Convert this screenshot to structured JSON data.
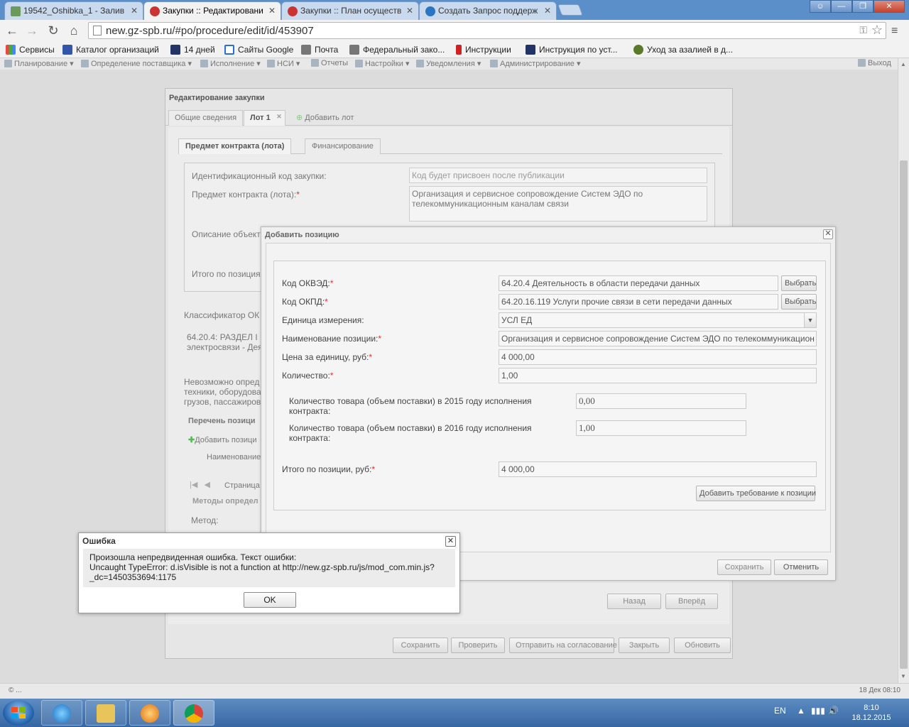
{
  "browser": {
    "tabs": [
      {
        "label": "19542_Oshibka_1 - Залив"
      },
      {
        "label": "Закупки :: Редактировани"
      },
      {
        "label": "Закупки :: План осуществ"
      },
      {
        "label": "Создать Запрос поддерж"
      }
    ],
    "url": "new.gz-spb.ru/#po/procedure/edit/id/453907",
    "bookmarks": [
      "Сервисы",
      "Каталог организаций",
      "14 дней",
      "Сайты Google",
      "Почта",
      "Федеральный зако...",
      "Инструкции",
      "Инструкция по уст...",
      "Уход за азалией в д..."
    ]
  },
  "app_menu": {
    "items": [
      "Планирование",
      "Определение поставщика",
      "Исполнение",
      "НСИ",
      "Отчеты",
      "Настройки",
      "Уведомления",
      "Администрирование"
    ],
    "exit_label": "Выход"
  },
  "main_window": {
    "title": "Редактирование закупки",
    "tabs": [
      "Общие сведения",
      "Лот 1",
      "Добавить лот"
    ],
    "subtabs": [
      "Предмет контракта (лота)",
      "Финансирование"
    ],
    "fields": {
      "id_code_label": "Идентификационный код закупки:",
      "id_code_placeholder": "Код будет присвоен после публикации",
      "subject_label": "Предмет контракта (лота):",
      "subject_value": "Организация и сервисное сопровождение Систем ЭДО по телекоммуникационным каналам связи",
      "description_label": "Описание объекта",
      "total_label": "Итого по позиция",
      "classifier_label": "Классификатор ОК",
      "classifier_text": "64.20.4: РАЗДЕЛ I",
      "classifier_text2": "электросвязи - Дея",
      "impossible_text1": "Невозможно опред",
      "impossible_text2": "техники, оборудова",
      "impossible_text3": "грузов, пассажиров",
      "positions_title": "Перечень позици",
      "add_position": "Добавить позици",
      "col_name": "Наименование",
      "page_label": "Страница",
      "methods_title": "Методы определ",
      "method_label": "Метод:"
    },
    "nav_buttons": [
      "Назад",
      "Вперёд"
    ],
    "bottom_buttons": [
      "Сохранить",
      "Проверить",
      "Отправить на согласование",
      "Закрыть",
      "Обновить"
    ]
  },
  "add_position_dialog": {
    "title": "Добавить позицию",
    "okved_label": "Код ОКВЭД:",
    "okved_value": "64.20.4 Деятельность в области передачи данных",
    "okpd_label": "Код ОКПД:",
    "okpd_value": "64.20.16.119 Услуги прочие связи в сети передачи данных",
    "choose_label": "Выбрать",
    "unit_label": "Единица измерения:",
    "unit_value": "УСЛ ЕД",
    "name_label": "Наименование позиции:",
    "name_value": "Организация и сервисное сопровождение Систем ЭДО по телекоммуникацион",
    "price_label": "Цена за единицу, руб:",
    "price_value": "4 000,00",
    "qty_label": "Количество:",
    "qty_value": "1,00",
    "qty2015_label": "Количество товара (объем поставки) в 2015 году исполнения контракта:",
    "qty2015_value": "0,00",
    "qty2016_label": "Количество товара (объем поставки) в 2016 году исполнения контракта:",
    "qty2016_value": "1,00",
    "total_label": "Итого по позиции, руб:",
    "total_value": "4 000,00",
    "add_requirement": "Добавить требование к позиции",
    "save": "Сохранить",
    "cancel": "Отменить"
  },
  "error_dialog": {
    "title": "Ошибка",
    "line1": "Произошла непредвиденная ошибка. Текст ошибки:",
    "line2": "Uncaught TypeError: d.isVisible is not a function at http://new.gz-spb.ru/js/mod_com.min.js?",
    "line3": "_dc=1450353694:1175",
    "ok": "OK"
  },
  "status": {
    "left": "© ...",
    "right": "18 Дек 08:10"
  },
  "taskbar": {
    "lang": "EN",
    "time": "8:10",
    "date": "18.12.2015"
  }
}
